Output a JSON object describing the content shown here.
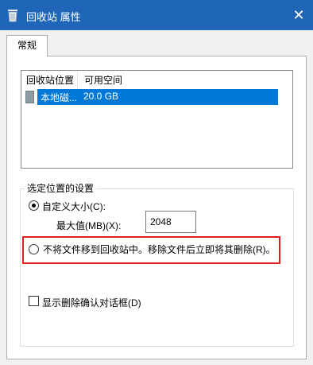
{
  "window": {
    "title": "回收站 属性",
    "close_glyph": "✕"
  },
  "tabs": [
    {
      "label": "常规"
    }
  ],
  "list": {
    "columns": [
      "回收站位置",
      "可用空间"
    ],
    "rows": [
      {
        "location": "本地磁...",
        "free_space": "20.0 GB",
        "selected": true
      }
    ]
  },
  "group": {
    "label": "选定位置的设置",
    "custom_size_label": "自定义大小(C):",
    "max_value_label": "最大值(MB)(X):",
    "max_value": "2048",
    "no_move_label": "不将文件移到回收站中。移除文件后立即将其删除(R)。",
    "custom_size_checked": true,
    "no_move_checked": false
  },
  "confirm_delete": {
    "label": "显示删除确认对话框(D)",
    "checked": false
  },
  "colors": {
    "titlebar": "#1f66b9",
    "selection": "#0078d7",
    "highlight_frame": "#e02020"
  }
}
